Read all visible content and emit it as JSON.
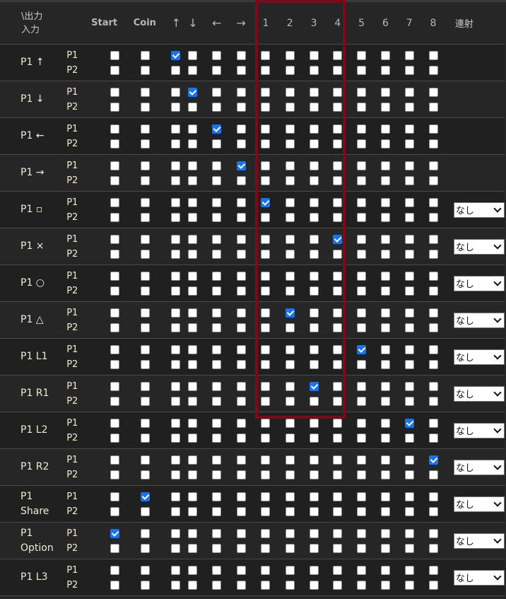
{
  "header": {
    "corner_line1": "\\出力",
    "corner_line2": "入力",
    "columns": [
      "Start",
      "Coin",
      "↑",
      "↓",
      "←",
      "→",
      "1",
      "2",
      "3",
      "4",
      "5",
      "6",
      "7",
      "8"
    ],
    "rensha": "連射"
  },
  "player_labels": [
    "P1",
    "P2"
  ],
  "select_default": "なし",
  "highlight": {
    "label": "columns 1-4",
    "color": "#7c0a1a"
  },
  "rows": [
    {
      "line1": "P1 ↑",
      "line2": "",
      "checked_p1": 2,
      "checked_p2": null,
      "has_select": false
    },
    {
      "line1": "P1 ↓",
      "line2": "",
      "checked_p1": 3,
      "checked_p2": null,
      "has_select": false
    },
    {
      "line1": "P1 ←",
      "line2": "",
      "checked_p1": 4,
      "checked_p2": null,
      "has_select": false
    },
    {
      "line1": "P1 →",
      "line2": "",
      "checked_p1": 5,
      "checked_p2": null,
      "has_select": false
    },
    {
      "line1": "P1 ▫",
      "line2": "",
      "checked_p1": 6,
      "checked_p2": null,
      "has_select": true,
      "select": "なし"
    },
    {
      "line1": "P1 ×",
      "line2": "",
      "checked_p1": 9,
      "checked_p2": null,
      "has_select": true,
      "select": "なし"
    },
    {
      "line1": "P1 ○",
      "line2": "",
      "checked_p1": null,
      "checked_p2": null,
      "has_select": true,
      "select": "なし"
    },
    {
      "line1": "P1 △",
      "line2": "",
      "checked_p1": 7,
      "checked_p2": null,
      "has_select": true,
      "select": "なし"
    },
    {
      "line1": "P1 L1",
      "line2": "",
      "checked_p1": 10,
      "checked_p2": null,
      "has_select": true,
      "select": "なし"
    },
    {
      "line1": "P1 R1",
      "line2": "",
      "checked_p1": 8,
      "checked_p2": null,
      "has_select": true,
      "select": "なし"
    },
    {
      "line1": "P1 L2",
      "line2": "",
      "checked_p1": 12,
      "checked_p2": null,
      "has_select": true,
      "select": "なし"
    },
    {
      "line1": "P1 R2",
      "line2": "",
      "checked_p1": 13,
      "checked_p2": null,
      "has_select": true,
      "select": "なし"
    },
    {
      "line1": "P1",
      "line2": "Share",
      "checked_p1": 1,
      "checked_p2": null,
      "has_select": true,
      "select": "なし"
    },
    {
      "line1": "P1",
      "line2": "Option",
      "checked_p1": 0,
      "checked_p2": null,
      "has_select": true,
      "select": "なし"
    },
    {
      "line1": "P1 L3",
      "line2": "",
      "checked_p1": null,
      "checked_p2": null,
      "has_select": true,
      "select": "なし"
    }
  ]
}
